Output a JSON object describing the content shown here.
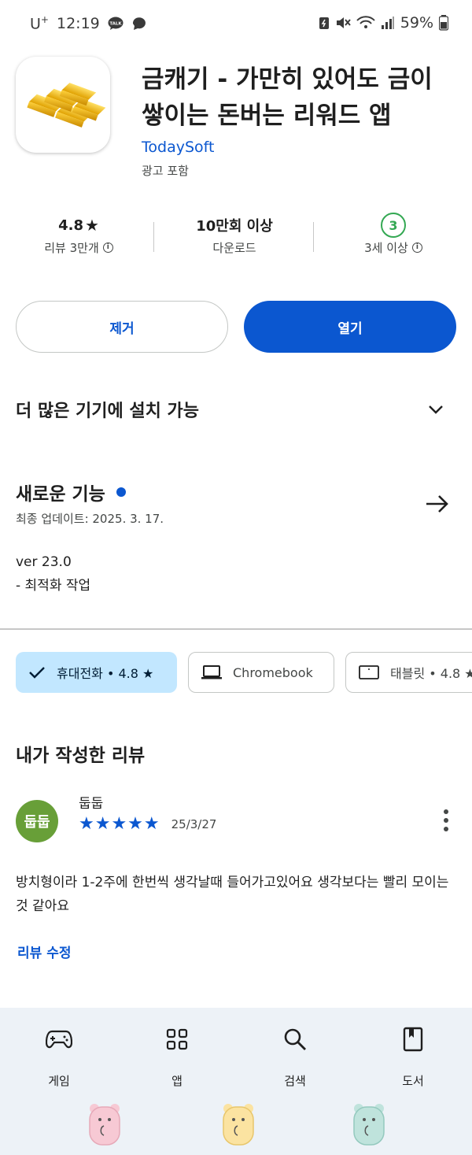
{
  "status_bar": {
    "carrier": "U",
    "carrier_sup": "+",
    "time": "12:19",
    "battery": "59%"
  },
  "app": {
    "title": "금캐기 - 가만히 있어도 금이 쌓이는 돈버는 리워드 앱",
    "developer": "TodaySoft",
    "ads_label": "광고 포함"
  },
  "stats": {
    "rating": "4.8",
    "rating_star": "★",
    "reviews_label": "리뷰 3만개",
    "downloads": "10만회 이상",
    "downloads_label": "다운로드",
    "age_badge": "3",
    "age_label": "3세 이상"
  },
  "buttons": {
    "remove": "제거",
    "open": "열기"
  },
  "install_more": {
    "label": "더 많은 기기에 설치 가능"
  },
  "whats_new": {
    "title": "새로운 기능",
    "date": "최종 업데이트: 2025. 3. 17.",
    "version": "ver 23.0",
    "note": "- 최적화 작업"
  },
  "device_chips": [
    {
      "label": "휴대전화 • 4.8 ★",
      "icon": "check-icon",
      "selected": true
    },
    {
      "label": "Chromebook",
      "icon": "laptop-icon",
      "selected": false
    },
    {
      "label": "태블릿 • 4.8 ★",
      "icon": "tablet-icon",
      "selected": false
    }
  ],
  "my_review": {
    "section_title": "내가 작성한 리뷰",
    "avatar_text": "둡둡",
    "name": "둡둡",
    "stars": "★★★★★",
    "date": "25/3/27",
    "text": "방치형이라 1-2주에 한번씩 생각날때 들어가고있어요 생각보다는 빨리 모이는 것 같아요",
    "edit_label": "리뷰 수정"
  },
  "bottom_nav": [
    {
      "label": "게임",
      "icon": "gamepad-icon"
    },
    {
      "label": "앱",
      "icon": "apps-grid-icon"
    },
    {
      "label": "검색",
      "icon": "search-icon"
    },
    {
      "label": "도서",
      "icon": "book-icon"
    }
  ],
  "colors": {
    "accent": "#0b57d0",
    "chip_selected": "#c2e7ff",
    "age_green": "#34a853",
    "avatar_green": "#689f38",
    "nav_bg": "#edf2f7"
  }
}
